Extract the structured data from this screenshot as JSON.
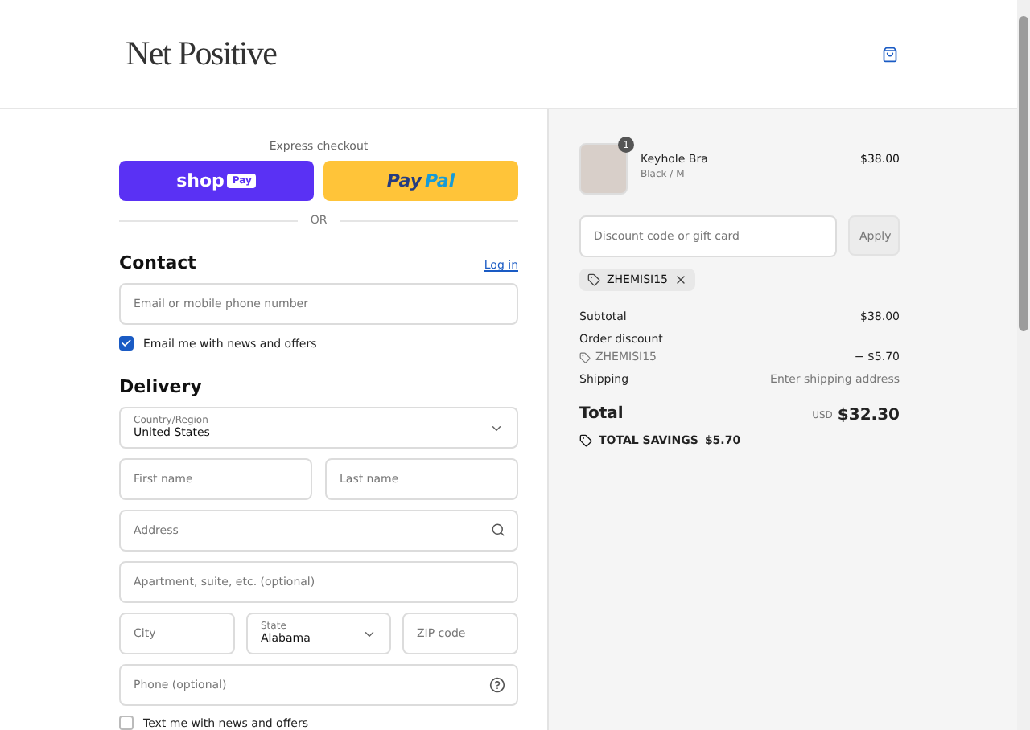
{
  "header": {
    "logo": "Net Positive"
  },
  "express": {
    "title": "Express checkout",
    "buttons": [
      {
        "kind": "shop",
        "label": "shop",
        "badge": "Pay"
      },
      {
        "kind": "paypal",
        "label": "Pay",
        "label_2": "Pal"
      }
    ],
    "divider": "OR"
  },
  "contact": {
    "heading": "Contact",
    "login": "Log in",
    "email": {
      "placeholder": "Email or mobile phone number"
    },
    "newsletter": {
      "label": "Email me with news and offers",
      "checked": true
    }
  },
  "delivery": {
    "heading": "Delivery",
    "rows": [
      [
        {
          "kind": "select",
          "label": "Country/Region",
          "value": "United States"
        }
      ],
      [
        {
          "kind": "input",
          "placeholder": "First name"
        },
        {
          "kind": "input",
          "placeholder": "Last name"
        }
      ],
      [
        {
          "kind": "lookup",
          "placeholder": "Address"
        }
      ],
      [
        {
          "kind": "input",
          "placeholder": "Apartment, suite, etc. (optional)"
        }
      ],
      [
        {
          "kind": "input",
          "placeholder": "City"
        },
        {
          "kind": "select",
          "label": "State",
          "value": "Alabama"
        },
        {
          "kind": "input",
          "placeholder": "ZIP code"
        }
      ],
      [
        {
          "kind": "phone",
          "placeholder": "Phone (optional)"
        }
      ]
    ],
    "sms": {
      "label": "Text me with news and offers",
      "checked": false
    }
  },
  "summary": {
    "item": {
      "name": "Keyhole Bra",
      "variant": "Black / M",
      "price": "$38.00",
      "quantity": "1"
    },
    "discount": {
      "placeholder": "Discount code or gift card",
      "button": "Apply"
    },
    "applied_code": "ZHEMISI15",
    "lines": [
      {
        "kind": "row",
        "label": "Subtotal",
        "value": "$38.00"
      },
      {
        "kind": "heading",
        "label": "Order discount"
      },
      {
        "kind": "code",
        "label": "ZHEMISI15",
        "value": "− $5.70"
      },
      {
        "kind": "muted",
        "label": "Shipping",
        "value": "Enter shipping address"
      }
    ],
    "total": {
      "label": "Total",
      "currency": "USD",
      "value": "$32.30"
    },
    "savings": {
      "label": "TOTAL SAVINGS",
      "value": "$5.70"
    }
  }
}
